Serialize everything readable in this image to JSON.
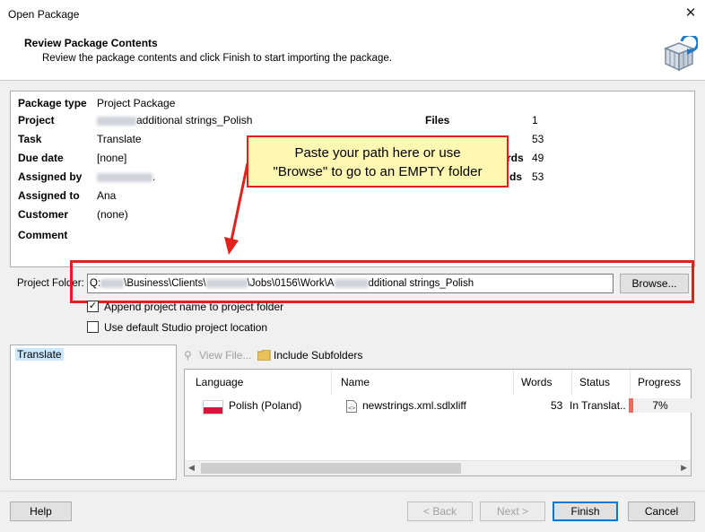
{
  "window": {
    "title": "Open Package",
    "close_glyph": "✕"
  },
  "header": {
    "title": "Review Package Contents",
    "subtitle": "Review the package contents and click Finish to start importing the package.",
    "icon": "package-import-icon"
  },
  "details": {
    "package_type": {
      "label": "Package type",
      "value": "Project Package"
    },
    "project": {
      "label": "Project",
      "value": "additional strings_Polish"
    },
    "task": {
      "label": "Task",
      "value": "Translate"
    },
    "due_date": {
      "label": "Due date",
      "value": "[none]"
    },
    "assigned_by": {
      "label": "Assigned by",
      "value": "."
    },
    "assigned_to": {
      "label": "Assigned to",
      "value": "Ana"
    },
    "customer": {
      "label": "Customer",
      "value": "(none)"
    },
    "comment": {
      "label": "Comment",
      "value": ""
    },
    "files": {
      "label": "Files",
      "value": "1"
    },
    "stat2": {
      "label": "",
      "value": "53"
    },
    "stat3": {
      "label": "rds",
      "value": "49"
    },
    "stat4": {
      "label": "ds",
      "value": "53"
    }
  },
  "callout": {
    "line1": "Paste your path here or use",
    "line2": "\"Browse\" to go to an EMPTY folder"
  },
  "project_folder": {
    "label": "Project Folder:",
    "path_seg1": "Q:",
    "path_seg2": "\\Business\\Clients\\",
    "path_seg3": "\\Jobs\\0156\\Work\\A",
    "path_seg4": "dditional strings_Polish",
    "browse_label": "Browse..."
  },
  "options": {
    "append_name": {
      "label": "Append project name to project folder",
      "checked": true,
      "glyph": "✓"
    },
    "use_default": {
      "label": "Use default Studio project location",
      "checked": false
    }
  },
  "tree": {
    "items": [
      "Translate"
    ]
  },
  "toolbar": {
    "view_file": "View File...",
    "include_subfolders": "Include Subfolders"
  },
  "files_grid": {
    "headers": [
      "Language",
      "Name",
      "Words",
      "Status",
      "Progress"
    ],
    "rows": [
      {
        "language": "Polish (Poland)",
        "name": "newstrings.xml.sdlxliff",
        "words": "53",
        "status": "In Translat...",
        "progress_text": "7%",
        "progress": 0.07
      }
    ]
  },
  "footer": {
    "help": "Help",
    "back": "< Back",
    "next": "Next >",
    "finish": "Finish",
    "cancel": "Cancel"
  },
  "colors": {
    "accent": "#0078d7",
    "annotation_red": "#e2211c",
    "callout_bg": "#fff8b3",
    "progress_fill": "#e96c5f"
  }
}
